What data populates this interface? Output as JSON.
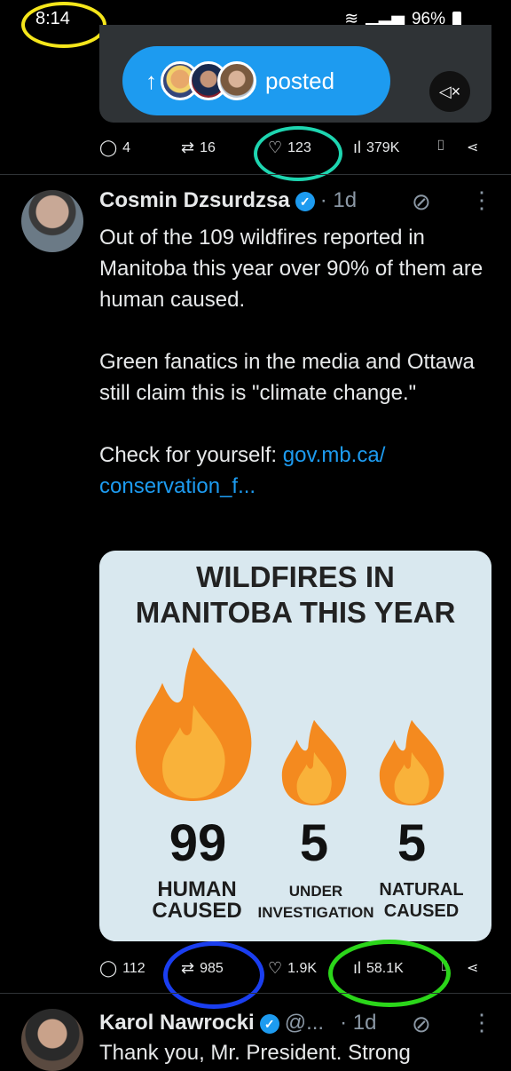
{
  "status": {
    "time": "8:14",
    "battery": "96%"
  },
  "top_card": {
    "posted_label": "posted",
    "arrow": "↑"
  },
  "prev_actions": {
    "replies": "4",
    "reposts": "16",
    "likes": "123",
    "views": "379K"
  },
  "tweet": {
    "author": "Cosmin Dzsurdzsa",
    "ago": "· 1d",
    "paragraph1": "Out of the 109 wildfires reported in Manitoba this year over 90% of them are human caused.",
    "paragraph2": "Green fanatics in the media and Ottawa still claim this is \"climate change.\"",
    "check_prefix": "Check for yourself: ",
    "link": "gov.mb.ca/ conservation_f..."
  },
  "infographic": {
    "title_line1": "WILDFIRES IN",
    "title_line2": "MANITOBA THIS YEAR",
    "items": [
      {
        "value": "99",
        "cap1": "HUMAN",
        "cap2": "CAUSED"
      },
      {
        "value": "5",
        "cap1": "UNDER",
        "cap2": "INVESTIGATION"
      },
      {
        "value": "5",
        "cap1": "NATURAL",
        "cap2": "CAUSED"
      }
    ]
  },
  "chart_data": {
    "type": "bar",
    "title": "WILDFIRES IN MANITOBA THIS YEAR",
    "categories": [
      "HUMAN CAUSED",
      "UNDER INVESTIGATION",
      "NATURAL CAUSED"
    ],
    "values": [
      99,
      5,
      5
    ]
  },
  "tweet_actions": {
    "replies": "112",
    "reposts": "985",
    "likes": "1.9K",
    "views": "58.1K"
  },
  "next_tweet": {
    "author": "Karol Nawrocki",
    "handle": "@...",
    "ago": "· 1d",
    "text": "Thank you, Mr. President. Strong"
  },
  "colors": {
    "accent": "#1d9bf0",
    "highlight_yellow": "#f5e61b",
    "highlight_teal": "#1ed5b0",
    "highlight_blue": "#1a3ef0",
    "highlight_green": "#2bd61a"
  },
  "icons": [
    "reply-icon",
    "repost-icon",
    "like-icon",
    "views-icon",
    "bookmark-icon",
    "share-icon",
    "verified-icon",
    "grok-icon",
    "more-icon",
    "mute-icon"
  ]
}
